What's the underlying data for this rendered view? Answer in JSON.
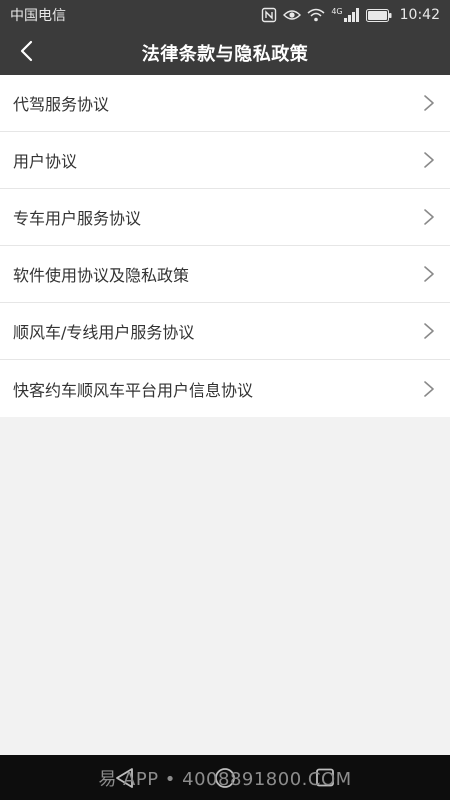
{
  "status_bar": {
    "carrier": "中国电信",
    "network": "4G",
    "time": "10:42"
  },
  "nav": {
    "title": "法律条款与隐私政策"
  },
  "items": [
    {
      "label": "代驾服务协议"
    },
    {
      "label": "用户协议"
    },
    {
      "label": "专车用户服务协议"
    },
    {
      "label": "软件使用协议及隐私政策"
    },
    {
      "label": "顺风车/专线用户服务协议"
    },
    {
      "label": "快客约车顺风车平台用户信息协议"
    }
  ],
  "watermark": {
    "text": "易 APP • 4008891800.COM"
  },
  "colors": {
    "bar": "#3b3b3b",
    "background": "#f2f2f2",
    "text": "#333333",
    "chevron": "#8a8a8a"
  }
}
